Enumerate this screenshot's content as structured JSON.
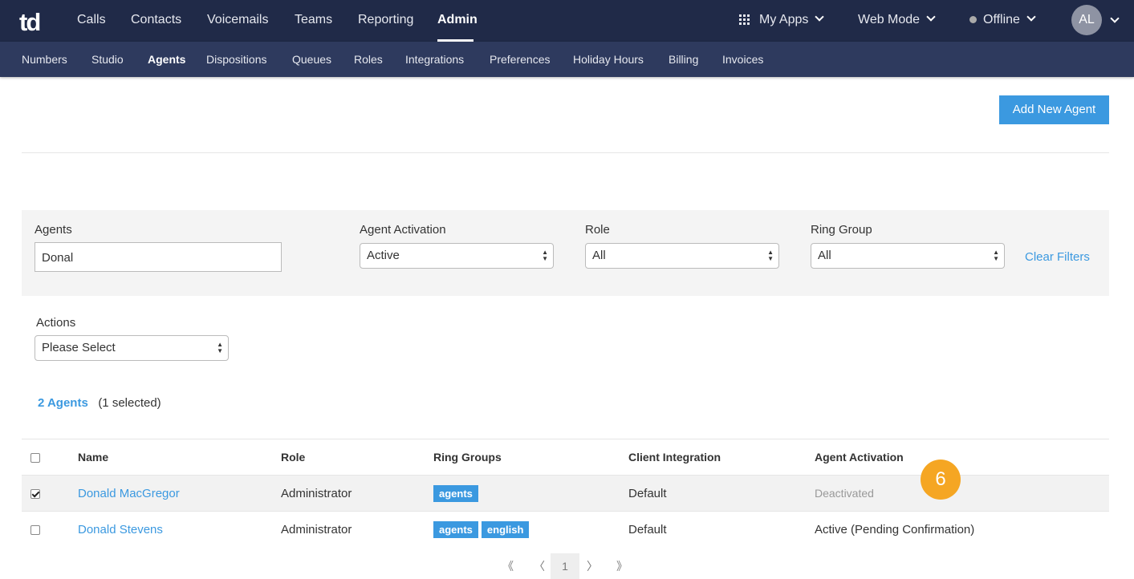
{
  "topnav": {
    "logo": "td",
    "items": [
      "Calls",
      "Contacts",
      "Voicemails",
      "Teams",
      "Reporting",
      "Admin"
    ],
    "my_apps": "My Apps",
    "web_mode": "Web Mode",
    "status": "Offline",
    "avatar_initials": "AL"
  },
  "subnav": {
    "items": [
      "Numbers",
      "Studio",
      "Agents",
      "Dispositions",
      "Queues",
      "Roles",
      "Integrations",
      "Preferences",
      "Holiday Hours",
      "Billing",
      "Invoices"
    ]
  },
  "add_button": "Add New Agent",
  "filters": {
    "agents_label": "Agents",
    "agents_value": "Donal",
    "activation_label": "Agent Activation",
    "activation_value": "Active",
    "role_label": "Role",
    "role_value": "All",
    "ring_group_label": "Ring Group",
    "ring_group_value": "All",
    "clear": "Clear Filters"
  },
  "actions": {
    "label": "Actions",
    "value": "Please Select"
  },
  "summary": {
    "count": "2 Agents",
    "selected": "(1 selected)"
  },
  "table": {
    "headers": [
      "Name",
      "Role",
      "Ring Groups",
      "Client Integration",
      "Agent Activation"
    ],
    "rows": [
      {
        "name": "Donald MacGregor",
        "role": "Administrator",
        "tags": [
          "agents"
        ],
        "integration": "Default",
        "activation": "Deactivated"
      },
      {
        "name": "Donald Stevens",
        "role": "Administrator",
        "tags": [
          "agents",
          "english"
        ],
        "integration": "Default",
        "activation": "Active (Pending Confirmation)"
      }
    ]
  },
  "badge": "6",
  "pagination": {
    "first": "《",
    "prev": "〈",
    "page": "1",
    "next": "〉",
    "last": "》"
  }
}
